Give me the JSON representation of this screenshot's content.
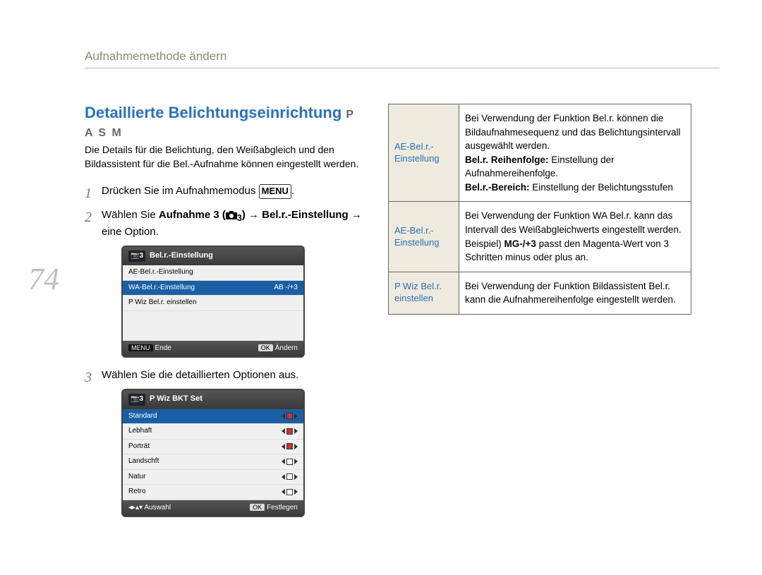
{
  "page_number": "74",
  "section_header": "Aufnahmemethode ändern",
  "title_blue": "Detaillierte Belichtungseinrichtung",
  "title_modes": "P A S M",
  "intro": "Die Details für die Belichtung, den Weißabgleich und den Bildassistent für die Bel.-Aufnahme können eingestellt werden.",
  "steps": {
    "s1": {
      "num": "1",
      "pre": "Drücken Sie im Aufnahmemodus ",
      "badge": "MENU",
      "post": "."
    },
    "s2": {
      "num": "2",
      "pre": "Wählen Sie ",
      "b1": "Aufnahme 3 (",
      "cam_sub": "3",
      "b2": ") → Bel.r.-Einstellung",
      "post": " → eine Option."
    },
    "s3": {
      "num": "3",
      "text": "Wählen Sie die detaillierten Optionen aus."
    }
  },
  "screen1": {
    "header_tag": "3",
    "header_title": "Bel.r.-Einstellung",
    "rows": [
      {
        "label": "AE-Bel.r.-Einstellung",
        "value": ""
      },
      {
        "label": "WA-Bel.r.-Einstellung",
        "value": "AB -/+3"
      },
      {
        "label": "P Wiz Bel.r. einstellen",
        "value": ""
      }
    ],
    "footer_left_pill": "MENU",
    "footer_left": "Ende",
    "footer_right_pill": "OK",
    "footer_right": "Ändern"
  },
  "screen2": {
    "header_tag": "3",
    "header_title": "P Wiz BKT Set",
    "rows": [
      {
        "label": "Standard",
        "checked": true
      },
      {
        "label": "Lebhaft",
        "checked": true
      },
      {
        "label": "Porträt",
        "checked": true
      },
      {
        "label": "Landschft",
        "checked": false
      },
      {
        "label": "Natur",
        "checked": false
      },
      {
        "label": "Retro",
        "checked": false
      }
    ],
    "footer_left": "Auswahl",
    "footer_right_pill": "OK",
    "footer_right": "Festlegen"
  },
  "table": {
    "r1": {
      "label": "AE-Bel.r.-Einstellung",
      "desc_pre": "Bei Verwendung der Funktion Bel.r. können die Bildaufnahmesequenz und das Belichtungsintervall ausgewählt werden.",
      "b1": "Bel.r. Reihenfolge:",
      "d1": " Einstellung der Aufnahmereihenfolge.",
      "b2": "Bel.r.-Bereich:",
      "d2": " Einstellung der Belichtungsstufen"
    },
    "r2": {
      "label": "AE-Bel.r.-Einstellung",
      "desc_pre": "Bei Verwendung der Funktion WA Bel.r. kann das Intervall des Weißabgleichwerts eingestellt werden.",
      "ex_pre": "Beispiel) ",
      "ex_b": "MG-/+3",
      "ex_post": " passt den Magenta-Wert von 3 Schritten minus oder plus an."
    },
    "r3": {
      "label": "P Wiz Bel.r. einstellen",
      "desc": "Bei Verwendung der Funktion Bildassistent Bel.r. kann die Aufnahmereihenfolge eingestellt werden."
    }
  }
}
